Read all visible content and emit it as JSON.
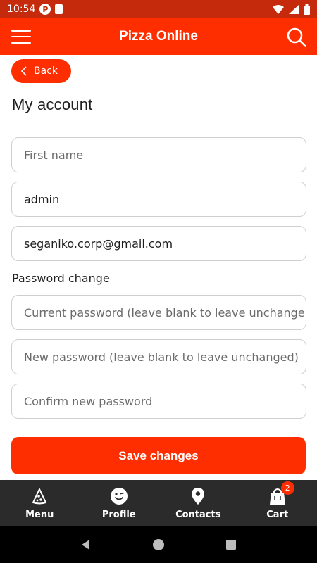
{
  "status_bar": {
    "time": "10:54",
    "p_icon": "P"
  },
  "app_bar": {
    "title": "Pizza Online",
    "menu_icon": "hamburger-icon",
    "search_icon": "search-icon"
  },
  "back_button": {
    "label": "Back"
  },
  "page_title": "My account",
  "profile_fields": {
    "first_name": {
      "placeholder": "First name",
      "value": ""
    },
    "last_name": {
      "value": "admin"
    },
    "email": {
      "value": "seganiko.corp@gmail.com"
    }
  },
  "password_section": {
    "label": "Password change",
    "current_password": {
      "placeholder": "Current password (leave blank to leave unchange"
    },
    "new_password": {
      "placeholder": "New password (leave blank to leave unchanged)"
    },
    "confirm_password": {
      "placeholder": "Confirm new password"
    }
  },
  "save_button": {
    "label": "Save changes"
  },
  "bottom_nav": {
    "items": [
      {
        "label": "Menu",
        "icon": "pizza-slice-icon"
      },
      {
        "label": "Profile",
        "icon": "smiley-icon"
      },
      {
        "label": "Contacts",
        "icon": "location-pin-icon"
      },
      {
        "label": "Cart",
        "icon": "shopping-bag-icon",
        "badge": "2"
      }
    ]
  },
  "colors": {
    "accent": "#ff2e00",
    "status_bar": "#c42a0b",
    "nav_bg": "#2b2b2b"
  }
}
